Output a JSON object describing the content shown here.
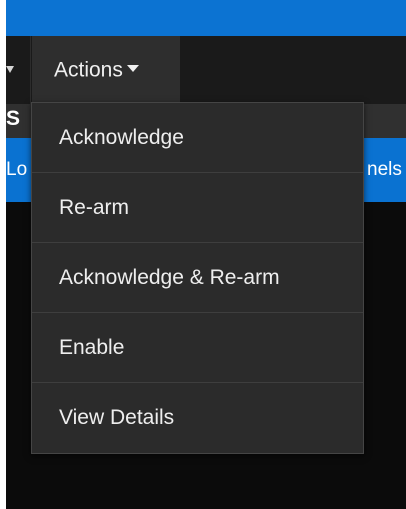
{
  "toolbar": {
    "actions_label": "Actions"
  },
  "table": {
    "header_partial": "S",
    "selected_row_left": "Lo",
    "selected_row_right": "nels"
  },
  "actions_menu": {
    "items": [
      {
        "label": "Acknowledge"
      },
      {
        "label": "Re-arm"
      },
      {
        "label": "Acknowledge & Re-arm"
      },
      {
        "label": "Enable"
      },
      {
        "label": "View Details"
      }
    ]
  },
  "colors": {
    "accent_blue": "#0c73d2",
    "menu_bg": "#2b2b2b",
    "page_bg": "#0b0b0b"
  }
}
